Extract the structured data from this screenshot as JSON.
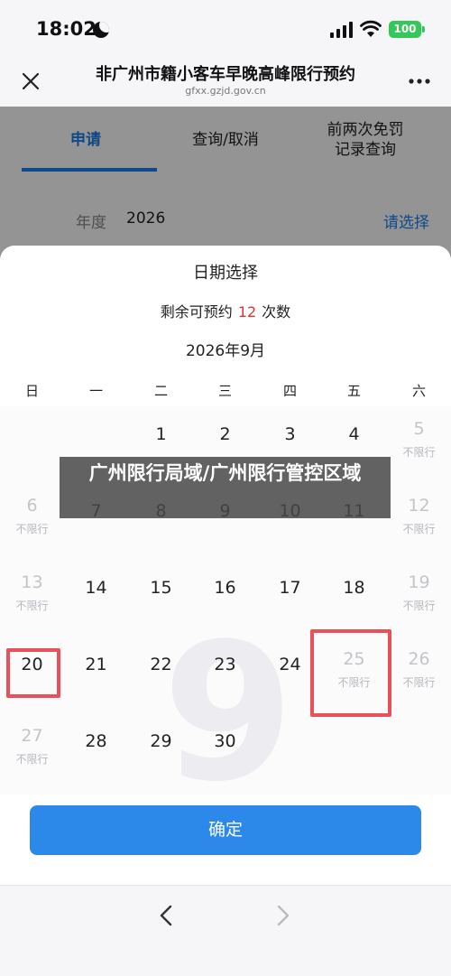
{
  "status_bar": {
    "time": "18:02",
    "battery": "100"
  },
  "nav": {
    "title": "非广州市籍小客车早晚高峰限行预约",
    "url": "gfxx.gzjd.gov.cn"
  },
  "tabs": [
    {
      "label": "申请",
      "active": true
    },
    {
      "label": "查询/取消",
      "active": false
    },
    {
      "label": "前两次免罚\n记录查询",
      "active": false
    }
  ],
  "year_row": {
    "label": "年度",
    "value": "2026",
    "action": "请选择"
  },
  "sheet": {
    "title": "日期选择",
    "remaining_prefix": "剩余可预约",
    "remaining_count": "12",
    "remaining_suffix": "次数",
    "month": "2026年9月",
    "month_watermark": "9",
    "weekdays": [
      "日",
      "一",
      "二",
      "三",
      "四",
      "五",
      "六"
    ],
    "no_restriction_label": "不限行",
    "weeks": [
      [
        null,
        null,
        "1",
        "2",
        "3",
        "4",
        "5"
      ],
      [
        "6",
        "7",
        "8",
        "9",
        "10",
        "11",
        "12"
      ],
      [
        "13",
        "14",
        "15",
        "16",
        "17",
        "18",
        "19"
      ],
      [
        "20",
        "21",
        "22",
        "23",
        "24",
        "25",
        "26"
      ],
      [
        "27",
        "28",
        "29",
        "30",
        null,
        null,
        null
      ]
    ],
    "day_labels": {
      "5": "不限行",
      "6": "不限行",
      "12": "不限行",
      "13": "不限行",
      "19": "不限行",
      "25": "不限行",
      "26": "不限行",
      "27": "不限行"
    },
    "confirm_label": "确定"
  },
  "watermark": {
    "text": "广州限行局域/广州限行管控区域"
  },
  "colors": {
    "accent": "#1a7ee8",
    "button": "#2c89ea",
    "highlight": "#e8505a",
    "count": "#e03030"
  }
}
